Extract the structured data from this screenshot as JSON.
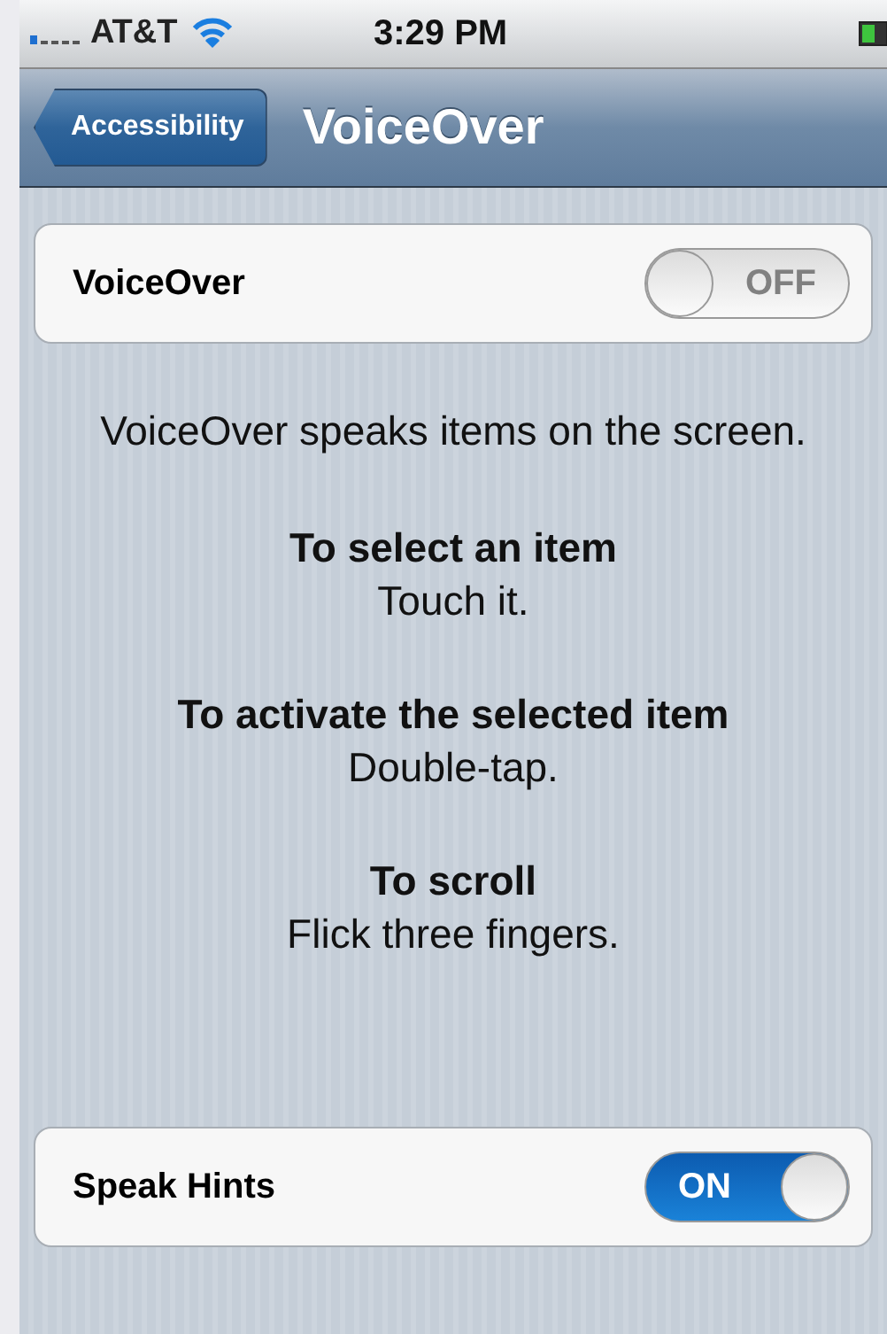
{
  "status_bar": {
    "carrier": "AT&T",
    "time": "3:29 PM"
  },
  "nav_bar": {
    "back_button": "Accessibility",
    "title": "VoiceOver"
  },
  "settings": [
    {
      "label": "VoiceOver",
      "on": false,
      "switch_text": "OFF"
    }
  ],
  "help": {
    "intro": "VoiceOver speaks items on the screen.",
    "sections": [
      {
        "heading": "To select an item",
        "text": "Touch it."
      },
      {
        "heading": "To activate the selected item",
        "text": "Double-tap."
      },
      {
        "heading": "To scroll",
        "text": "Flick three fingers."
      }
    ]
  },
  "settings_2": [
    {
      "label": "Speak Hints",
      "on": true,
      "switch_text": "ON"
    }
  ]
}
